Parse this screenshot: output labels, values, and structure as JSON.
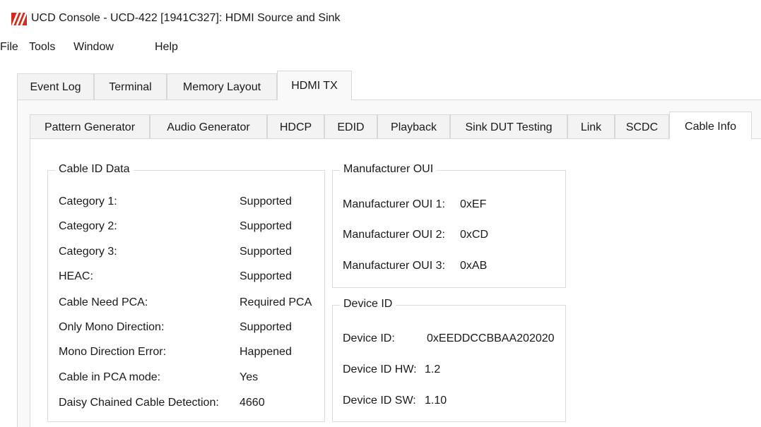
{
  "window": {
    "title": "UCD Console - UCD-422 [1941C327]: HDMI Source and Sink"
  },
  "menu": [
    "File",
    "Tools",
    "Window",
    "Help"
  ],
  "outer_tabs": [
    {
      "label": "Event Log"
    },
    {
      "label": "Terminal"
    },
    {
      "label": "Memory Layout"
    },
    {
      "label": "HDMI TX"
    }
  ],
  "inner_tabs": [
    {
      "label": "Pattern Generator"
    },
    {
      "label": "Audio Generator"
    },
    {
      "label": "HDCP"
    },
    {
      "label": "EDID"
    },
    {
      "label": "Playback"
    },
    {
      "label": "Sink DUT Testing"
    },
    {
      "label": "Link"
    },
    {
      "label": "SCDC"
    },
    {
      "label": "Cable Info"
    }
  ],
  "cable_id": {
    "title": "Cable ID Data",
    "rows": [
      {
        "label": "Category 1:",
        "value": "Supported"
      },
      {
        "label": "Category 2:",
        "value": "Supported"
      },
      {
        "label": "Category 3:",
        "value": "Supported"
      },
      {
        "label": "HEAC:",
        "value": "Supported"
      },
      {
        "label": "Cable Need PCA:",
        "value": "Required PCA"
      },
      {
        "label": "Only Mono Direction:",
        "value": "Supported"
      },
      {
        "label": "Mono Direction Error:",
        "value": "Happened"
      },
      {
        "label": "Cable in PCA mode:",
        "value": "Yes"
      },
      {
        "label": "Daisy Chained Cable Detection:",
        "value": "4660"
      }
    ]
  },
  "manufacturer_oui": {
    "title": "Manufacturer OUI",
    "rows": [
      {
        "label": "Manufacturer OUI 1:",
        "value": "0xEF"
      },
      {
        "label": "Manufacturer OUI 2:",
        "value": "0xCD"
      },
      {
        "label": "Manufacturer OUI 3:",
        "value": "0xAB"
      }
    ]
  },
  "device_id": {
    "title": "Device ID",
    "rows": [
      {
        "label": "Device ID:",
        "value": "0xEEDDCCBBAA202020"
      },
      {
        "label": "Device ID HW:",
        "value": "1.2"
      },
      {
        "label": "Device ID SW:",
        "value": "1.10"
      }
    ]
  },
  "colors": {
    "logo": "#d42a1c",
    "panel": "#f9f9f9",
    "tab": "#f3f3f3",
    "border": "#d8d8d8"
  }
}
